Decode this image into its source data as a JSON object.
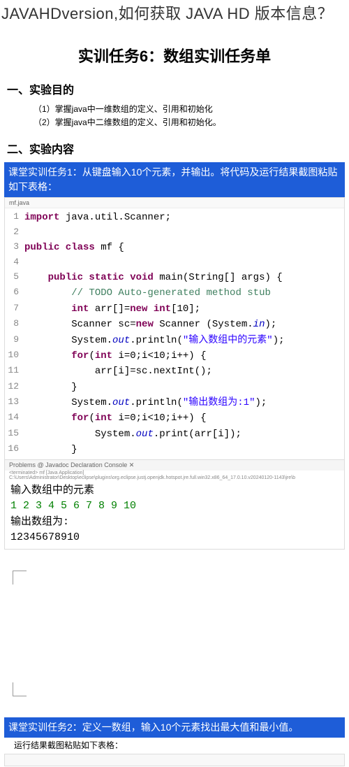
{
  "topQuestion": "JAVAHDversion,如何获取 JAVA HD 版本信息？",
  "mainTitle": "实训任务6：数组实训任务单",
  "section1": {
    "heading": "一、实验目的",
    "items": [
      "（1）掌握java中一维数组的定义、引用和初始化",
      "（2）掌握java中二维数组的定义、引用和初始化。"
    ]
  },
  "section2": {
    "heading": "二、实验内容"
  },
  "task1": {
    "header": "课堂实训任务1：从键盘输入10个元素，并输出。将代码及运行结果截图粘贴如下表格：",
    "codeTab": "mf.java",
    "code": [
      {
        "n": "1",
        "tokens": [
          {
            "t": "import ",
            "c": "kw"
          },
          {
            "t": "java.util.Scanner;"
          }
        ]
      },
      {
        "n": "2",
        "tokens": []
      },
      {
        "n": "3",
        "tokens": [
          {
            "t": "public class ",
            "c": "kw"
          },
          {
            "t": "mf {"
          }
        ]
      },
      {
        "n": "4",
        "tokens": []
      },
      {
        "n": "5",
        "tokens": [
          {
            "t": "    "
          },
          {
            "t": "public static void ",
            "c": "kw"
          },
          {
            "t": "main(String[] args) {"
          }
        ]
      },
      {
        "n": "6",
        "tokens": [
          {
            "t": "        "
          },
          {
            "t": "// TODO Auto-generated method stub",
            "c": "comment"
          }
        ]
      },
      {
        "n": "7",
        "tokens": [
          {
            "t": "        "
          },
          {
            "t": "int ",
            "c": "kw"
          },
          {
            "t": "arr[]="
          },
          {
            "t": "new ",
            "c": "kw"
          },
          {
            "t": "int",
            "c": "kw"
          },
          {
            "t": "[10];"
          }
        ]
      },
      {
        "n": "8",
        "tokens": [
          {
            "t": "        Scanner sc="
          },
          {
            "t": "new ",
            "c": "kw"
          },
          {
            "t": "Scanner (System."
          },
          {
            "t": "in",
            "c": "italic"
          },
          {
            "t": ");"
          }
        ]
      },
      {
        "n": "9",
        "tokens": [
          {
            "t": "        System."
          },
          {
            "t": "out",
            "c": "italic"
          },
          {
            "t": ".println("
          },
          {
            "t": "\"输入数组中的元素\"",
            "c": "str"
          },
          {
            "t": ");"
          }
        ]
      },
      {
        "n": "10",
        "tokens": [
          {
            "t": "        "
          },
          {
            "t": "for",
            "c": "kw"
          },
          {
            "t": "("
          },
          {
            "t": "int ",
            "c": "kw"
          },
          {
            "t": "i=0;i<10;i++) {"
          }
        ]
      },
      {
        "n": "11",
        "tokens": [
          {
            "t": "            arr[i]=sc.nextInt();"
          }
        ]
      },
      {
        "n": "12",
        "tokens": [
          {
            "t": "        }"
          }
        ]
      },
      {
        "n": "13",
        "tokens": [
          {
            "t": "        System."
          },
          {
            "t": "out",
            "c": "italic"
          },
          {
            "t": ".println("
          },
          {
            "t": "\"输出数组为:1\"",
            "c": "str"
          },
          {
            "t": ");"
          }
        ]
      },
      {
        "n": "14",
        "tokens": [
          {
            "t": "        "
          },
          {
            "t": "for",
            "c": "kw"
          },
          {
            "t": "("
          },
          {
            "t": "int ",
            "c": "kw"
          },
          {
            "t": "i=0;i<10;i++) {"
          }
        ]
      },
      {
        "n": "15",
        "tokens": [
          {
            "t": "            System."
          },
          {
            "t": "out",
            "c": "italic"
          },
          {
            "t": ".print(arr[i]);"
          }
        ]
      },
      {
        "n": "16",
        "tokens": [
          {
            "t": "        }"
          }
        ]
      }
    ],
    "consoleTabs": "Problems  @ Javadoc  Declaration  Console ✕",
    "consoleMeta": "<terminated> mf [Java Application] C:\\Users\\Administrator\\Desktop\\eclipse\\plugins\\org.eclipse.justj.openjdk.hotspot.jre.full.win32.x86_64_17.0.10.v20240120-1143\\jre\\b",
    "consoleLines": [
      {
        "text": "输入数组中的元素",
        "c": ""
      },
      {
        "text": "1 2 3 4 5 6 7 8 9 10",
        "c": "console-green"
      },
      {
        "text": "输出数组为:",
        "c": ""
      },
      {
        "text": "12345678910",
        "c": ""
      }
    ]
  },
  "task2": {
    "header": "课堂实训任务2：定义一数组，输入10个元素找出最大值和最小值。",
    "note": "运行结果截图粘贴如下表格："
  }
}
